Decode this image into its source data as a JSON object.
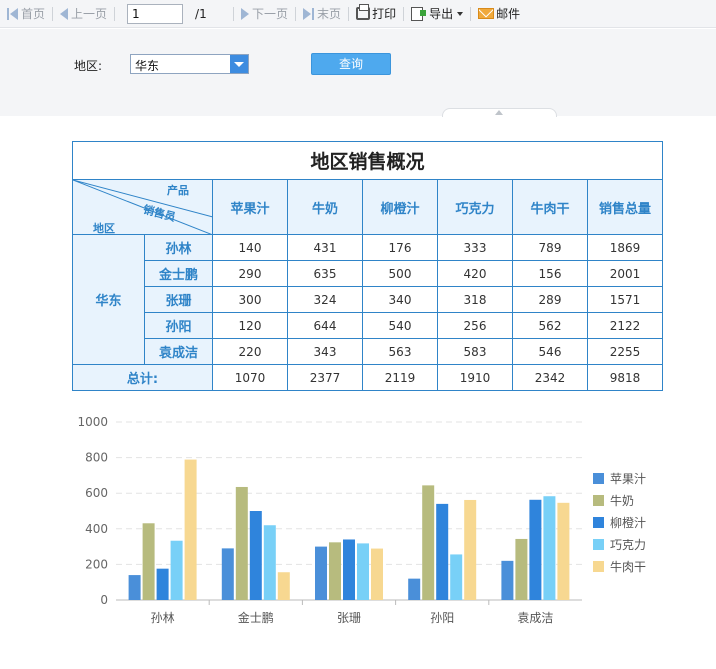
{
  "toolbar": {
    "first": "首页",
    "prev": "上一页",
    "page_value": "1",
    "page_total": "/1",
    "next": "下一页",
    "last": "末页",
    "print": "打印",
    "export": "导出",
    "mail": "邮件"
  },
  "params": {
    "region_label": "地区:",
    "region_value": "华东",
    "query_label": "查询"
  },
  "report": {
    "title": "地区销售概况",
    "corner": {
      "product": "产品",
      "salesperson": "销售员",
      "region": "地区"
    },
    "columns": [
      "苹果汁",
      "牛奶",
      "柳橙汁",
      "巧克力",
      "牛肉干",
      "销售总量"
    ],
    "region": "华东",
    "rows": [
      {
        "name": "孙林",
        "values": [
          "140",
          "431",
          "176",
          "333",
          "789",
          "1869"
        ]
      },
      {
        "name": "金士鹏",
        "values": [
          "290",
          "635",
          "500",
          "420",
          "156",
          "2001"
        ]
      },
      {
        "name": "张珊",
        "values": [
          "300",
          "324",
          "340",
          "318",
          "289",
          "1571"
        ]
      },
      {
        "name": "孙阳",
        "values": [
          "120",
          "644",
          "540",
          "256",
          "562",
          "2122"
        ]
      },
      {
        "name": "袁成洁",
        "values": [
          "220",
          "343",
          "563",
          "583",
          "546",
          "2255"
        ]
      }
    ],
    "total_label": "总计:",
    "totals": [
      "1070",
      "2377",
      "2119",
      "1910",
      "2342",
      "9818"
    ]
  },
  "chart_data": {
    "type": "bar",
    "categories": [
      "孙林",
      "金士鹏",
      "张珊",
      "孙阳",
      "袁成洁"
    ],
    "series": [
      {
        "name": "苹果汁",
        "color": "#4a8fd9",
        "values": [
          140,
          290,
          300,
          120,
          220
        ]
      },
      {
        "name": "牛奶",
        "color": "#b7bb7e",
        "values": [
          431,
          635,
          324,
          644,
          343
        ]
      },
      {
        "name": "柳橙汁",
        "color": "#2f84dc",
        "values": [
          176,
          500,
          340,
          540,
          563
        ]
      },
      {
        "name": "巧克力",
        "color": "#78d0f7",
        "values": [
          333,
          420,
          318,
          256,
          583
        ]
      },
      {
        "name": "牛肉干",
        "color": "#f7d891",
        "values": [
          789,
          156,
          289,
          562,
          546
        ]
      }
    ],
    "ylim": [
      0,
      1000
    ],
    "yticks": [
      "0",
      "200",
      "400",
      "600",
      "800",
      "1000"
    ],
    "grid": true,
    "legend_position": "right"
  }
}
